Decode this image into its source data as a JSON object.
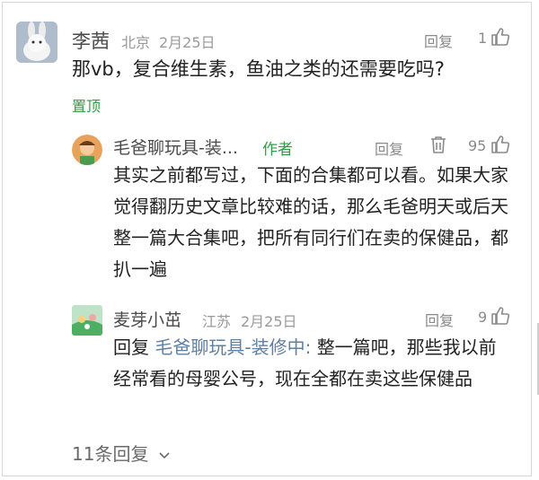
{
  "comment": {
    "user": "李茜",
    "location": "北京",
    "date": "2月25日",
    "reply_label": "回复",
    "likes": "1",
    "text": "那vb，复合维生素，鱼油之类的还需要吃吗?",
    "pin_label": "置顶"
  },
  "replies": [
    {
      "user": "毛爸聊玩具-装...",
      "author_tag": "作者",
      "reply_label": "回复",
      "likes": "95",
      "text": "其实之前都写过，下面的合集都可以看。如果大家觉得翻历史文章比较难的话，那么毛爸明天或后天整一篇大合集吧，把所有同行们在卖的保健品，都扒一遍"
    },
    {
      "user": "麦芽小茁",
      "location": "江苏",
      "date": "2月25日",
      "reply_label": "回复",
      "likes": "9",
      "reply_prefix": "回复",
      "reply_target": "毛爸聊玩具-装修中:",
      "text": "整一篇吧，那些我以前经常看的母婴公号，现在全都在卖这些保健品"
    }
  ],
  "footer": {
    "more_replies": "11条回复"
  }
}
